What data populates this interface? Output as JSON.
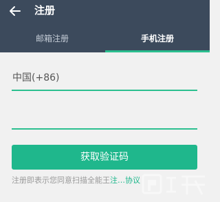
{
  "header": {
    "title": "注册",
    "back_icon": "arrow-left-icon",
    "background": "#3c4a5c"
  },
  "tabs": [
    {
      "label": "邮箱注册",
      "active": false
    },
    {
      "label": "手机注册",
      "active": true
    }
  ],
  "form": {
    "country": "中国(+86)",
    "phone_value": "",
    "submit_label": "获取验证码"
  },
  "agreement": {
    "text": "注册即表示您同意扫描全能王",
    "link": "注…协议"
  },
  "watermark": {
    "logo": "PC6 游戏网"
  },
  "colors": {
    "accent": "#1fb78c",
    "underline": "#2bbf8f",
    "background": "#f1f1f1"
  }
}
